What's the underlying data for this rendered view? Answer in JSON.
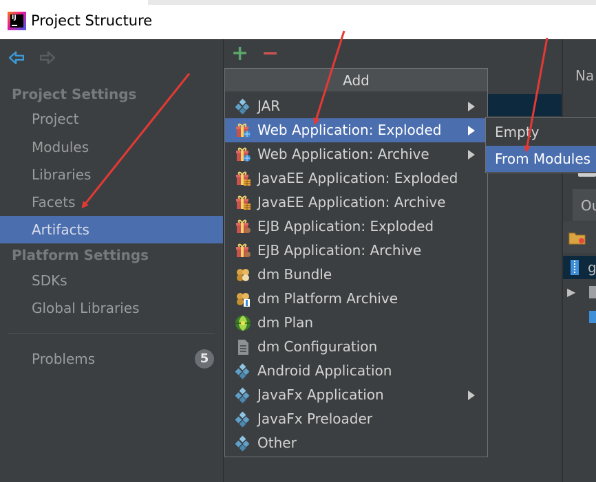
{
  "window": {
    "title": "Project Structure"
  },
  "sidebar": {
    "sections": [
      {
        "title": "Project Settings",
        "items": [
          "Project",
          "Modules",
          "Libraries",
          "Facets",
          "Artifacts"
        ]
      },
      {
        "title": "Platform Settings",
        "items": [
          "SDKs",
          "Global Libraries"
        ]
      }
    ],
    "problems": {
      "label": "Problems",
      "count": "5"
    }
  },
  "toolbar": {
    "add_symbol": "+",
    "remove_symbol": "−"
  },
  "add_menu": {
    "title": "Add",
    "items": [
      {
        "label": "JAR",
        "icon": "diamond-icon",
        "submenu": true
      },
      {
        "label": "Web Application: Exploded",
        "icon": "gift-web-icon",
        "submenu": true,
        "highlighted": true
      },
      {
        "label": "Web Application: Archive",
        "icon": "gift-web-icon",
        "submenu": true
      },
      {
        "label": "JavaEE Application: Exploded",
        "icon": "gift-ee-icon",
        "submenu": false
      },
      {
        "label": "JavaEE Application: Archive",
        "icon": "gift-ee-icon",
        "submenu": false
      },
      {
        "label": "EJB Application: Exploded",
        "icon": "gift-ejb-icon",
        "submenu": false
      },
      {
        "label": "EJB Application: Archive",
        "icon": "gift-ejb-icon",
        "submenu": false
      },
      {
        "label": "dm Bundle",
        "icon": "bundle-icon",
        "submenu": false
      },
      {
        "label": "dm Platform Archive",
        "icon": "platform-archive-icon",
        "submenu": false
      },
      {
        "label": "dm Plan",
        "icon": "plan-icon",
        "submenu": false
      },
      {
        "label": "dm Configuration",
        "icon": "document-icon",
        "submenu": false
      },
      {
        "label": "Android Application",
        "icon": "diamond-icon",
        "submenu": false
      },
      {
        "label": "JavaFx Application",
        "icon": "diamond-icon",
        "submenu": true
      },
      {
        "label": "JavaFx Preloader",
        "icon": "diamond-icon",
        "submenu": false
      },
      {
        "label": "Other",
        "icon": "diamond-icon",
        "submenu": false
      }
    ]
  },
  "sub_menu": {
    "items": [
      "Empty",
      "From Modules"
    ]
  },
  "right_panel": {
    "name_label": "Na",
    "tab_label": "Ou",
    "row_label": "g"
  },
  "colors": {
    "selection": "#4b6eaf",
    "background": "#3c3f41",
    "annotation": "#e53935"
  }
}
